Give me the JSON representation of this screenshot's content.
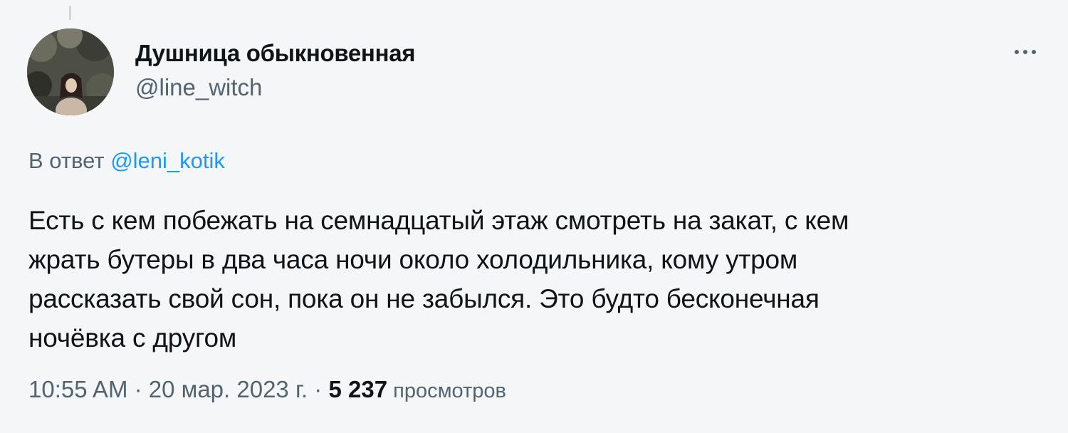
{
  "author": {
    "display_name": "Душница обыкновенная",
    "handle": "@line_witch"
  },
  "reply": {
    "prefix": "В ответ ",
    "mention": "@leni_kotik"
  },
  "tweet": {
    "text": "Есть с кем побежать на семнадцатый этаж смотреть на закат, с кем\nжрать бутеры в два часа ночи около холодильника, кому утром\nрассказать свой сон, пока он не забылся. Это будто бесконечная\nночёвка с другом"
  },
  "meta": {
    "time": "10:55 AM",
    "separator1": " · ",
    "date": "20 мар. 2023 г.",
    "separator2": " · ",
    "views_count": "5 237",
    "views_label": " просмотров"
  },
  "icons": {
    "more": "more-horizontal-icon"
  },
  "colors": {
    "link": "#1d9bf0",
    "secondary_text": "#536471",
    "primary_text": "#0f1419",
    "background": "#f5f6f7"
  }
}
